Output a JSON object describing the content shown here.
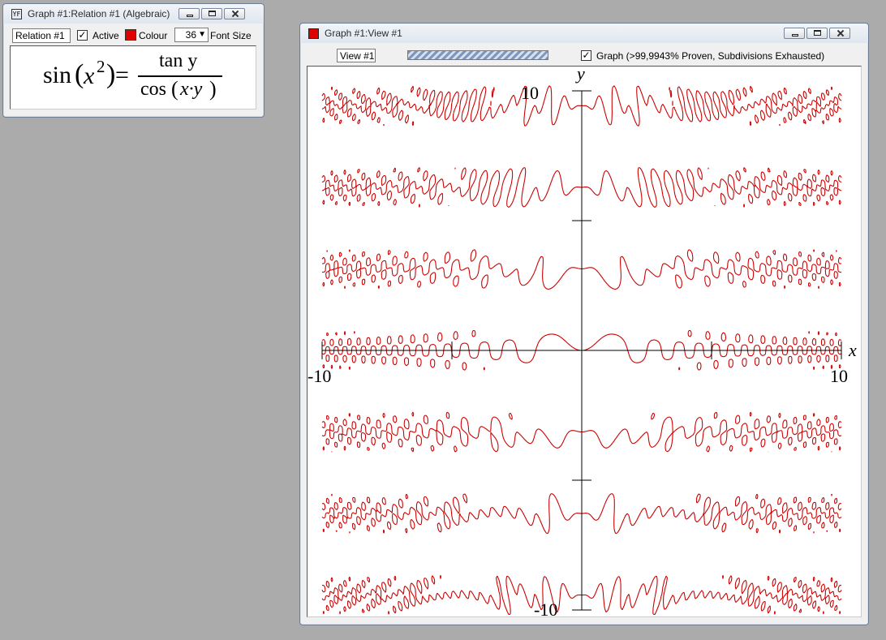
{
  "relation_window": {
    "title": "Graph #1:Relation #1 (Algebraic)",
    "app_icon": "YF",
    "relation_name": "Relation #1",
    "active_label": "Active",
    "active_checked": "✓",
    "colour_label": "Colour",
    "colour_value": "#e00000",
    "font_size_value": "36",
    "font_size_arrow": "▼",
    "font_size_label": "Font Size",
    "equation": {
      "lhs_sin": "sin",
      "lhs_paren_open": "(",
      "lhs_x": "x",
      "lhs_exp": "2",
      "lhs_paren_close": ")",
      "equals": "=",
      "numerator": "tan y",
      "den_cos": "cos",
      "den_paren_open": "(",
      "den_arg": "x·y",
      "den_paren_close": ")"
    }
  },
  "view_window": {
    "title": "Graph #1:View #1",
    "view_name": "View #1",
    "graph_checked": "✓",
    "graph_status": "Graph (>99,9943% Proven, Subdivisions Exhausted)",
    "plot": {
      "x_axis_label": "x",
      "y_axis_label": "y",
      "x_min_label": "-10",
      "x_max_label": "10",
      "y_max_label": "10",
      "y_min_label": "-10",
      "curve_color": "#cc0000",
      "axis_color": "#000000",
      "xlim": [
        -10,
        10
      ],
      "ylim": [
        -10,
        10
      ]
    }
  }
}
